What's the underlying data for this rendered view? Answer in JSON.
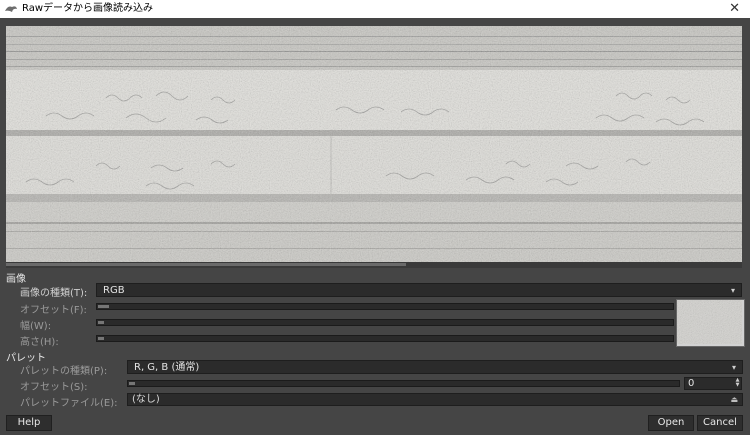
{
  "window": {
    "title": "Rawデータから画像読み込み",
    "close_glyph": "✕"
  },
  "image_section": {
    "heading": "画像",
    "type_label": "画像の種類(T):",
    "type_value": "RGB",
    "offset_label": "オフセット(F):",
    "offset_value": 0.02,
    "width_label": "幅(W):",
    "width_value": 0.01,
    "height_label": "高さ(H):",
    "height_value": 0.01
  },
  "palette_section": {
    "heading": "パレット",
    "type_label": "パレットの種類(P):",
    "type_value": "R, G, B (通常)",
    "offset_label": "オフセット(S):",
    "offset_value": "0",
    "offset_slider": 0.0,
    "file_label": "パレットファイル(E):",
    "file_value": "(なし)"
  },
  "buttons": {
    "help": "Help",
    "open": "Open",
    "cancel": "Cancel"
  },
  "icons": {
    "app": "gimp-icon",
    "close": "close-icon",
    "dropdown": "chevron-down-icon",
    "file": "folder-icon",
    "spin": "spin-arrows-icon"
  },
  "colors": {
    "background": "#454545",
    "field": "#2b2b2b",
    "preview": "#d7d6d1"
  }
}
